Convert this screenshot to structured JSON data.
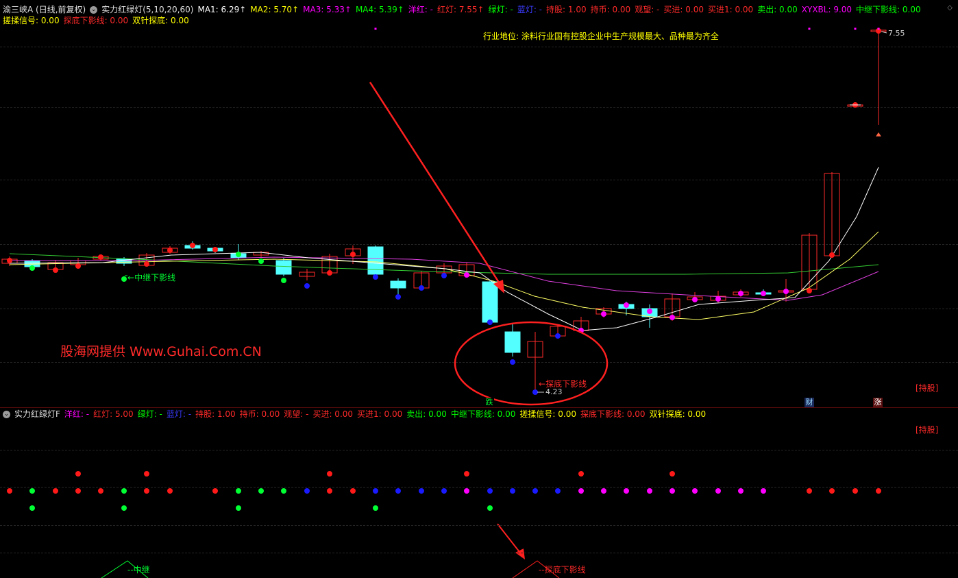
{
  "header": {
    "stock_name": "渝三峡A (日线,前复权)",
    "indicator_name": "实力红绿灯(5,10,20,60)",
    "items": [
      {
        "label": "MA1: 6.29↑",
        "color": "#ffffff"
      },
      {
        "label": "MA2: 5.70↑",
        "color": "#ffff00"
      },
      {
        "label": "MA3: 5.33↑",
        "color": "#ff00ff"
      },
      {
        "label": "MA4: 5.39↑",
        "color": "#00ff00"
      },
      {
        "label": "洋红: -",
        "color": "#ff00ff"
      },
      {
        "label": "红灯: 7.55↑",
        "color": "#ff2a2a"
      },
      {
        "label": "绿灯: -",
        "color": "#00ff00"
      },
      {
        "label": "蓝灯: -",
        "color": "#3a3aff"
      },
      {
        "label": "持股: 1.00",
        "color": "#ff2a2a"
      },
      {
        "label": "持币: 0.00",
        "color": "#ff2a2a"
      },
      {
        "label": "观望: -",
        "color": "#ff2a2a"
      },
      {
        "label": "买进: 0.00",
        "color": "#ff2a2a"
      },
      {
        "label": "买进1: 0.00",
        "color": "#ff2a2a"
      },
      {
        "label": "卖出: 0.00",
        "color": "#00ff00"
      },
      {
        "label": "XYXBL: 9.00",
        "color": "#ff00ff"
      },
      {
        "label": "中继下影线: 0.00",
        "color": "#00ff00"
      }
    ],
    "items_row2": [
      {
        "label": "搓揉信号: 0.00",
        "color": "#ffff00"
      },
      {
        "label": "探底下影线: 0.00",
        "color": "#ff2a2a"
      },
      {
        "label": "双针探底: 0.00",
        "color": "#ffff00"
      }
    ]
  },
  "main_chart": {
    "industry_note": "行业地位: 涂料行业国有控股企业中生产规模最大、品种最为齐全",
    "watermark": "股海网提供 Www.Guhai.Com.CN",
    "high_label": "7.55",
    "low_label": "4.23",
    "annotation_relay": "中继下影线",
    "annotation_bottom": "探底下影线",
    "holding_badge": "[持股]",
    "marker_die": "跌",
    "marker_cai": "财",
    "marker_zhang": "涨"
  },
  "sub_pane": {
    "title": "实力红绿灯F",
    "items": [
      {
        "label": "洋红: -",
        "color": "#ff00ff"
      },
      {
        "label": "红灯: 5.00",
        "color": "#ff2a2a"
      },
      {
        "label": "绿灯: -",
        "color": "#00ff00"
      },
      {
        "label": "蓝灯: -",
        "color": "#3a3aff"
      },
      {
        "label": "持股: 1.00",
        "color": "#ff2a2a"
      },
      {
        "label": "持币: 0.00",
        "color": "#ff2a2a"
      },
      {
        "label": "观望: -",
        "color": "#ff2a2a"
      },
      {
        "label": "买进: 0.00",
        "color": "#ff2a2a"
      },
      {
        "label": "买进1: 0.00",
        "color": "#ff2a2a"
      },
      {
        "label": "卖出: 0.00",
        "color": "#00ff00"
      },
      {
        "label": "中继下影线: 0.00",
        "color": "#00ff00"
      },
      {
        "label": "搓揉信号: 0.00",
        "color": "#ffff00"
      },
      {
        "label": "探底下影线: 0.00",
        "color": "#ff2a2a"
      },
      {
        "label": "双针探底: 0.00",
        "color": "#ffff00"
      }
    ],
    "holding_badge": "[持股]",
    "relay_label": "中继",
    "bottom_label": "探底下影线"
  },
  "colors": {
    "up": "#ff2a2a",
    "down": "#54ffff",
    "red_dot": "#ff1a1a",
    "green_dot": "#00ff33",
    "blue_dot": "#1a1aff",
    "magenta_dot": "#ff00ff",
    "ma1": "#ffffff",
    "ma2": "#ffff66",
    "ma3": "#e040e0",
    "ma4": "#33cc33"
  }
}
